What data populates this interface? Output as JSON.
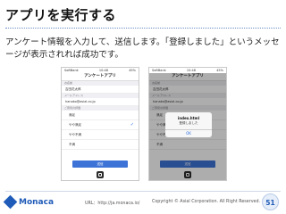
{
  "slide": {
    "title": "アプリを実行する",
    "description": "アンケート情報を入力して、送信します。「登録しました」というメッセージが表示されれば成功です。"
  },
  "phones": [
    {
      "time": "10:48",
      "signal": "SoftBank",
      "battery": "45%",
      "nav_title": "アンケートアプリ",
      "name_label": "お名前",
      "name_value": "吉田花太郎",
      "email_label": "メールアドレス",
      "email_value": "hanako@asial.co.jp",
      "rating_label": "ご意見の評価",
      "options": [
        "満足",
        "やや満足",
        "やや不満",
        "不満"
      ],
      "selected_index": 1,
      "submit_label": "送信"
    },
    {
      "time": "10:48",
      "signal": "SoftBank",
      "battery": "45%",
      "nav_title": "アンケートアプリ",
      "name_label": "お名前",
      "name_value": "吉田花太郎",
      "email_label": "メールアドレス",
      "email_value": "hanako@asial.co.jp",
      "rating_label": "ご意見の評価",
      "options": [
        "満足",
        "やや満足",
        "やや不満",
        "不満"
      ],
      "submit_label": "送信",
      "alert": {
        "title": "index.html",
        "message": "登録しました",
        "ok_label": "OK"
      }
    }
  ],
  "footer": {
    "logo_text": "Monaca",
    "url": "URL：http://ja.monaca.io/",
    "copyright": "Copyright © Asial Corporation. All Right Reserved.",
    "page_number": "51"
  },
  "colors": {
    "accent": "#1f5bb8",
    "button": "#3d73d6"
  }
}
